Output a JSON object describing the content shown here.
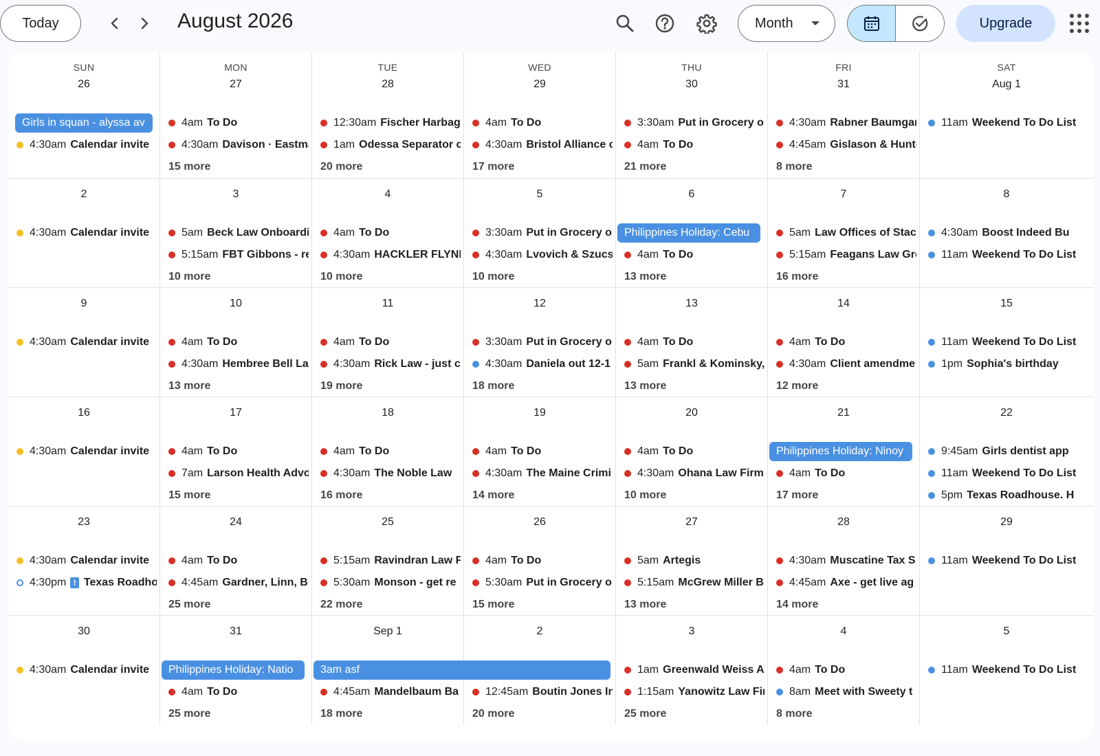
{
  "header": {
    "today_label": "Today",
    "title": "August 2026",
    "view_label": "Month",
    "upgrade_label": "Upgrade"
  },
  "icons": {
    "prev": "chevron-left-icon",
    "next": "chevron-right-icon",
    "search": "search-icon",
    "help": "help-icon",
    "settings": "gear-icon",
    "calendar": "calendar-icon",
    "tasks": "check-circle-icon",
    "apps": "apps-grid-icon"
  },
  "colors": {
    "red": "#d93025",
    "yellow": "#f6bf26",
    "blue": "#4a90e2",
    "chip": "#4a90e2",
    "accent_toggle": "#c2e7ff",
    "upgrade_bg": "#d3e3fd"
  },
  "weekdays": [
    "SUN",
    "MON",
    "TUE",
    "WED",
    "THU",
    "FRI",
    "SAT"
  ],
  "weeks": [
    [
      {
        "day": "26",
        "events": [
          {
            "time": "4:30am",
            "title": "Calendar invite",
            "color": "yellow"
          }
        ],
        "chip": {
          "text": "Girls in squan - alyssa av"
        },
        "more": ""
      },
      {
        "day": "27",
        "events": [
          {
            "time": "4am",
            "title": "To Do",
            "color": "red"
          },
          {
            "time": "4:30am",
            "title": "Davison · Eastman",
            "color": "red"
          }
        ],
        "more": "15 more"
      },
      {
        "day": "28",
        "events": [
          {
            "time": "12:30am",
            "title": "Fischer Harbage",
            "color": "red"
          },
          {
            "time": "1am",
            "title": "Odessa Separator c",
            "color": "red"
          }
        ],
        "more": "20 more"
      },
      {
        "day": "29",
        "events": [
          {
            "time": "4am",
            "title": "To Do",
            "color": "red"
          },
          {
            "time": "4:30am",
            "title": "Bristol Alliance c",
            "color": "red"
          }
        ],
        "more": "17 more"
      },
      {
        "day": "30",
        "events": [
          {
            "time": "3:30am",
            "title": "Put in Grocery o",
            "color": "red"
          },
          {
            "time": "4am",
            "title": "To Do",
            "color": "red"
          }
        ],
        "more": "21 more"
      },
      {
        "day": "31",
        "events": [
          {
            "time": "4:30am",
            "title": "Rabner Baumgart",
            "color": "red"
          },
          {
            "time": "4:45am",
            "title": "Gislason & Hunter",
            "color": "red"
          }
        ],
        "more": "8 more"
      },
      {
        "day": "Aug 1",
        "events": [
          {
            "time": "11am",
            "title": "Weekend To Do List",
            "color": "blue"
          }
        ],
        "more": ""
      }
    ],
    [
      {
        "day": "2",
        "events": [
          {
            "time": "4:30am",
            "title": "Calendar invite",
            "color": "yellow"
          }
        ],
        "more": ""
      },
      {
        "day": "3",
        "events": [
          {
            "time": "5am",
            "title": "Beck Law Onboarding",
            "color": "red"
          },
          {
            "time": "5:15am",
            "title": "FBT Gibbons - re",
            "color": "red"
          }
        ],
        "more": "10 more"
      },
      {
        "day": "4",
        "events": [
          {
            "time": "4am",
            "title": "To Do",
            "color": "red"
          },
          {
            "time": "4:30am",
            "title": "HACKLER FLYNN",
            "color": "red"
          }
        ],
        "more": "10 more"
      },
      {
        "day": "5",
        "events": [
          {
            "time": "3:30am",
            "title": "Put in Grocery o",
            "color": "red"
          },
          {
            "time": "4:30am",
            "title": "Lvovich & Szucs",
            "color": "red"
          }
        ],
        "more": "10 more"
      },
      {
        "day": "6",
        "events": [
          {
            "time": "4am",
            "title": "To Do",
            "color": "red"
          }
        ],
        "chip": {
          "text": "Philippines Holiday: Cebu"
        },
        "more": "13 more"
      },
      {
        "day": "7",
        "events": [
          {
            "time": "5am",
            "title": "Law Offices of Stac",
            "color": "red"
          },
          {
            "time": "5:15am",
            "title": "Feagans Law Grc",
            "color": "red"
          }
        ],
        "more": "16 more"
      },
      {
        "day": "8",
        "events": [
          {
            "time": "4:30am",
            "title": "Boost Indeed Bu",
            "color": "blue"
          },
          {
            "time": "11am",
            "title": "Weekend To Do List",
            "color": "blue"
          }
        ],
        "more": ""
      }
    ],
    [
      {
        "day": "9",
        "events": [
          {
            "time": "4:30am",
            "title": "Calendar invite",
            "color": "yellow"
          }
        ],
        "more": ""
      },
      {
        "day": "10",
        "events": [
          {
            "time": "4am",
            "title": "To Do",
            "color": "red"
          },
          {
            "time": "4:30am",
            "title": "Hembree Bell La",
            "color": "red"
          }
        ],
        "more": "13 more"
      },
      {
        "day": "11",
        "events": [
          {
            "time": "4am",
            "title": "To Do",
            "color": "red"
          },
          {
            "time": "4:30am",
            "title": "Rick Law - just c",
            "color": "red"
          }
        ],
        "more": "19 more"
      },
      {
        "day": "12",
        "events": [
          {
            "time": "3:30am",
            "title": "Put in Grocery o",
            "color": "red"
          },
          {
            "time": "4:30am",
            "title": "Daniela out 12-1",
            "color": "blue"
          }
        ],
        "more": "18 more"
      },
      {
        "day": "13",
        "events": [
          {
            "time": "4am",
            "title": "To Do",
            "color": "red"
          },
          {
            "time": "5am",
            "title": "Frankl & Kominsky,",
            "color": "red"
          }
        ],
        "more": "13 more"
      },
      {
        "day": "14",
        "events": [
          {
            "time": "4am",
            "title": "To Do",
            "color": "red"
          },
          {
            "time": "4:30am",
            "title": "Client amendme",
            "color": "red"
          }
        ],
        "more": "12 more"
      },
      {
        "day": "15",
        "events": [
          {
            "time": "11am",
            "title": "Weekend To Do List",
            "color": "blue"
          },
          {
            "time": "1pm",
            "title": "Sophia's birthday",
            "color": "blue"
          }
        ],
        "more": ""
      }
    ],
    [
      {
        "day": "16",
        "events": [
          {
            "time": "4:30am",
            "title": "Calendar invite",
            "color": "yellow"
          }
        ],
        "more": ""
      },
      {
        "day": "17",
        "events": [
          {
            "time": "4am",
            "title": "To Do",
            "color": "red"
          },
          {
            "time": "7am",
            "title": "Larson Health Advo",
            "color": "red"
          }
        ],
        "more": "15 more"
      },
      {
        "day": "18",
        "events": [
          {
            "time": "4am",
            "title": "To Do",
            "color": "red"
          },
          {
            "time": "4:30am",
            "title": "The Noble Law",
            "color": "red"
          }
        ],
        "more": "16 more"
      },
      {
        "day": "19",
        "events": [
          {
            "time": "4am",
            "title": "To Do",
            "color": "red"
          },
          {
            "time": "4:30am",
            "title": "The Maine Crimi",
            "color": "red"
          }
        ],
        "more": "14 more"
      },
      {
        "day": "20",
        "events": [
          {
            "time": "4am",
            "title": "To Do",
            "color": "red"
          },
          {
            "time": "4:30am",
            "title": "Ohana Law Firm",
            "color": "red"
          }
        ],
        "more": "10 more"
      },
      {
        "day": "21",
        "events": [
          {
            "time": "4am",
            "title": "To Do",
            "color": "red"
          }
        ],
        "chip": {
          "text": "Philippines Holiday: Ninoy"
        },
        "more": "17 more"
      },
      {
        "day": "22",
        "events": [
          {
            "time": "9:45am",
            "title": "Girls dentist app",
            "color": "blue"
          },
          {
            "time": "11am",
            "title": "Weekend To Do List",
            "color": "blue"
          },
          {
            "time": "5pm",
            "title": "Texas Roadhouse. H",
            "color": "blue"
          }
        ],
        "more": ""
      }
    ],
    [
      {
        "day": "23",
        "events": [
          {
            "time": "4:30am",
            "title": "Calendar invite",
            "color": "yellow"
          },
          {
            "time": "4:30pm",
            "title": "Texas Roadhouse",
            "color": "ring",
            "alert": "!"
          }
        ],
        "more": ""
      },
      {
        "day": "24",
        "events": [
          {
            "time": "4am",
            "title": "To Do",
            "color": "red"
          },
          {
            "time": "4:45am",
            "title": "Gardner, Linn, Bu",
            "color": "red"
          }
        ],
        "more": "25 more"
      },
      {
        "day": "25",
        "events": [
          {
            "time": "5:15am",
            "title": "Ravindran Law Fi",
            "color": "red"
          },
          {
            "time": "5:30am",
            "title": "Monson - get re",
            "color": "red"
          }
        ],
        "more": "22 more"
      },
      {
        "day": "26",
        "events": [
          {
            "time": "4am",
            "title": "To Do",
            "color": "red"
          },
          {
            "time": "5:30am",
            "title": "Put in Grocery o",
            "color": "red"
          }
        ],
        "more": "15 more"
      },
      {
        "day": "27",
        "events": [
          {
            "time": "5am",
            "title": "Artegis",
            "color": "red"
          },
          {
            "time": "5:15am",
            "title": "McGrew Miller Bi",
            "color": "red"
          }
        ],
        "more": "13 more"
      },
      {
        "day": "28",
        "events": [
          {
            "time": "4:30am",
            "title": "Muscatine Tax S",
            "color": "red"
          },
          {
            "time": "4:45am",
            "title": "Axe - get live ag",
            "color": "red"
          }
        ],
        "more": "14 more"
      },
      {
        "day": "29",
        "events": [
          {
            "time": "11am",
            "title": "Weekend To Do List",
            "color": "blue"
          }
        ],
        "more": ""
      }
    ],
    [
      {
        "day": "30",
        "events": [
          {
            "time": "4:30am",
            "title": "Calendar invite",
            "color": "yellow"
          }
        ],
        "more": ""
      },
      {
        "day": "31",
        "events": [
          {
            "time": "4am",
            "title": "To Do",
            "color": "red"
          }
        ],
        "chip": {
          "text": "Philippines Holiday: Natio"
        },
        "more": "25 more"
      },
      {
        "day": "Sep 1",
        "events": [
          {
            "time": "4:45am",
            "title": "Mandelbaum Ba",
            "color": "red"
          }
        ],
        "more": "18 more"
      },
      {
        "day": "2",
        "events": [
          {
            "time": "12:45am",
            "title": "Boutin Jones In",
            "color": "red"
          }
        ],
        "more": "20 more"
      },
      {
        "day": "3",
        "events": [
          {
            "time": "1am",
            "title": "Greenwald Weiss At",
            "color": "red"
          },
          {
            "time": "1:15am",
            "title": "Yanowitz Law Firm",
            "color": "red"
          }
        ],
        "more": "25 more"
      },
      {
        "day": "4",
        "events": [
          {
            "time": "4am",
            "title": "To Do",
            "color": "red"
          },
          {
            "time": "8am",
            "title": "Meet with Sweety t",
            "color": "blue"
          }
        ],
        "more": "8 more"
      },
      {
        "day": "5",
        "events": [
          {
            "time": "11am",
            "title": "Weekend To Do List",
            "color": "blue"
          }
        ],
        "more": ""
      }
    ]
  ],
  "spanning_chip": {
    "text": "3am asf"
  }
}
